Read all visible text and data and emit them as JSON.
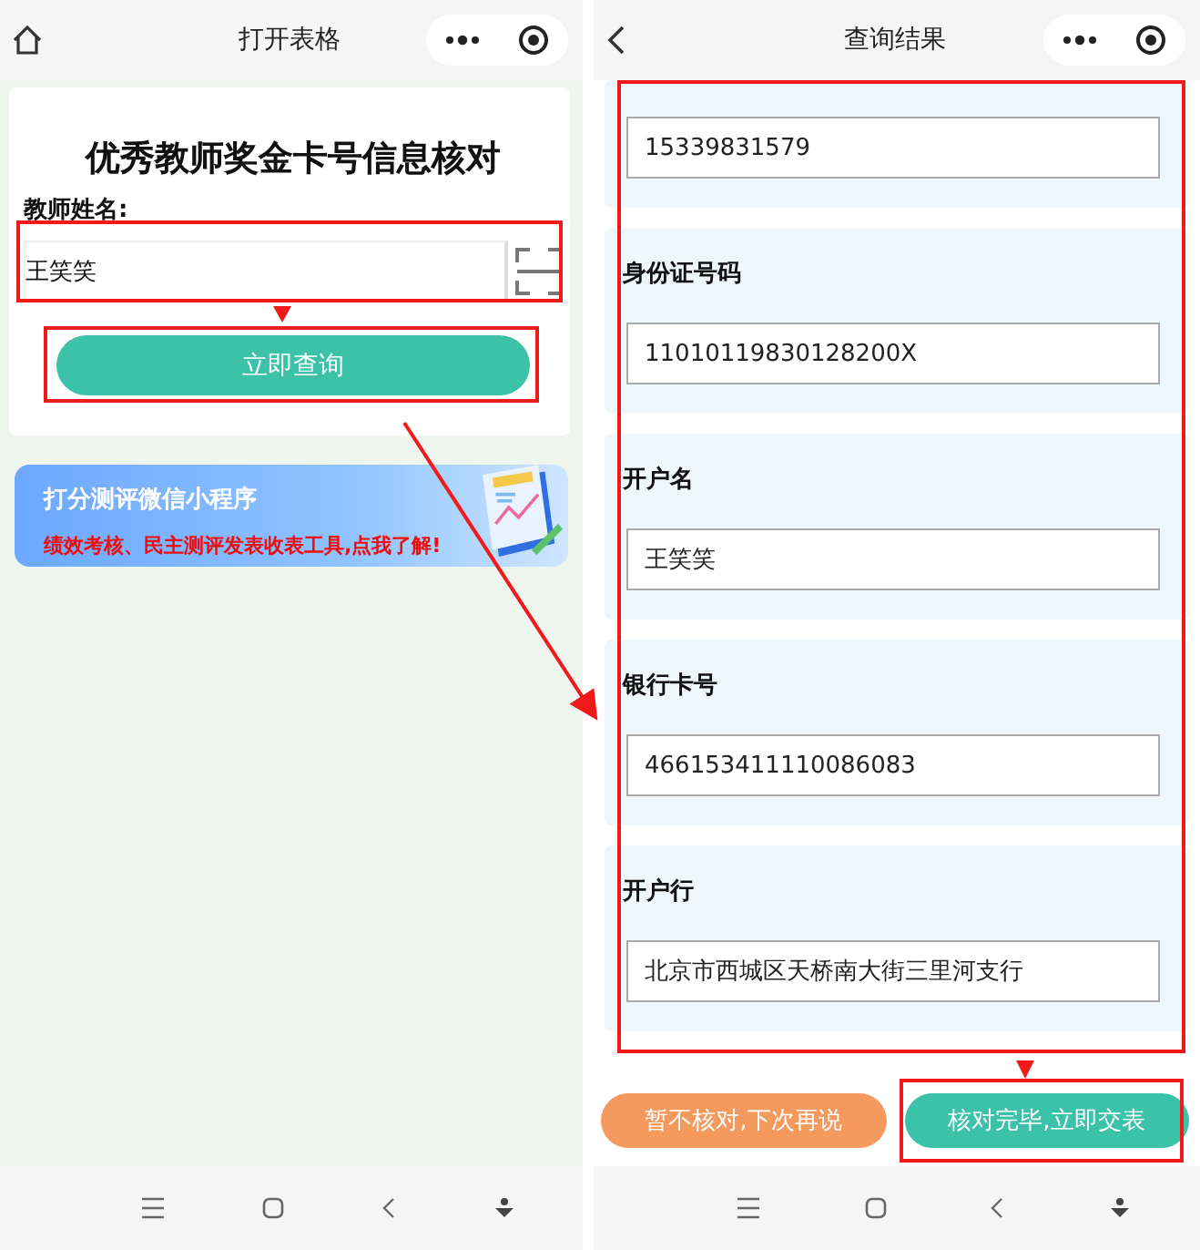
{
  "left_screen": {
    "nav": {
      "kind": "home",
      "title": "打开表格"
    },
    "form": {
      "title": "优秀教师奖金卡号信息核对",
      "field_label": "教师姓名:",
      "field_value": "王笑笑",
      "button": "立即查询"
    },
    "banner": {
      "title": "打分测评微信小程序",
      "subtitle": "绩效考核、民主测评发表收表工具,点我了解!"
    }
  },
  "right_screen": {
    "nav": {
      "kind": "back",
      "title": "查询结果"
    },
    "fields": [
      {
        "value": "15339831579"
      },
      {
        "label": "身份证号码",
        "value": "11010119830128200X"
      },
      {
        "label": "开户名",
        "value": "王笑笑"
      },
      {
        "label": "银行卡号",
        "value": "466153411110086083"
      },
      {
        "label": "开户行",
        "value": "北京市西城区天桥南大街三里河支行"
      }
    ],
    "buttons": [
      {
        "label": "暂不核对,下次再说",
        "kind": "secondary"
      },
      {
        "label": "核对完毕,立即交表",
        "kind": "primary"
      }
    ]
  }
}
